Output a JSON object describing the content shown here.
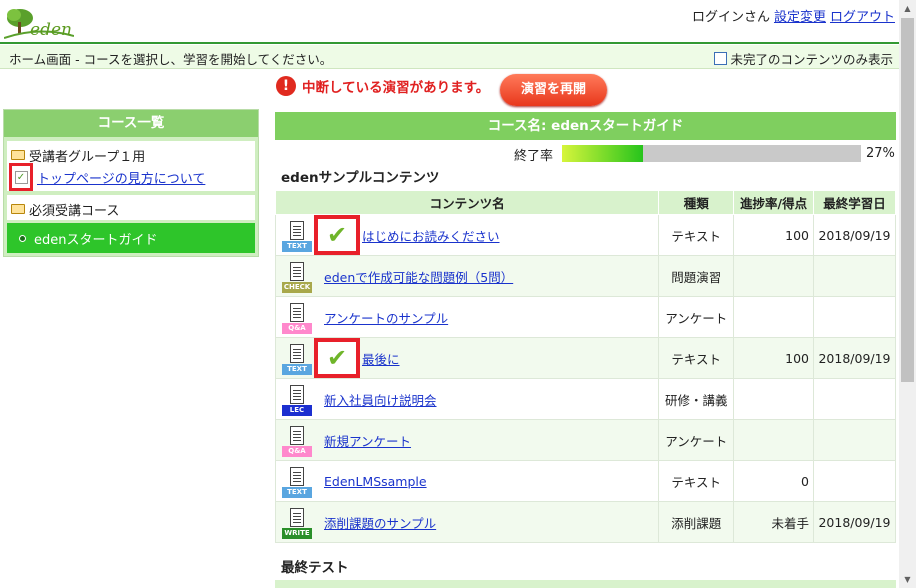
{
  "header": {
    "logo_text": "eden",
    "user_name": "ログインさん",
    "settings_link": "設定変更",
    "logout_link": "ログアウト"
  },
  "statusbar": {
    "message": "ホーム画面 - コースを選択し、学習を開始してください。",
    "filter_label": "未完了のコンテンツのみ表示"
  },
  "sidebar": {
    "title": "コース一覧",
    "groups": [
      {
        "label": "受講者グループ１用",
        "items": [
          {
            "label": "トップページの見方について"
          }
        ]
      },
      {
        "label": "必須受講コース",
        "items": [
          {
            "label": "edenスタートガイド"
          }
        ]
      }
    ]
  },
  "alert": {
    "icon": "!",
    "message": "中断している演習があります。",
    "button": "演習を再開"
  },
  "course": {
    "header": "コース名: edenスタートガイド",
    "progress_label": "終了率",
    "progress_value": 27,
    "progress_text": "27%"
  },
  "sections": {
    "contents_title": "edenサンプルコンテンツ",
    "final_title": "最終テスト"
  },
  "table": {
    "headers": [
      "コンテンツ名",
      "種類",
      "進捗率/得点",
      "最終学習日"
    ],
    "rows": [
      {
        "icon": "TEXT",
        "checked": true,
        "name": "はじめにお読みください",
        "type": "テキスト",
        "progress": "100",
        "date": "2018/09/19"
      },
      {
        "icon": "CHECK",
        "checked": false,
        "name": "edenで作成可能な問題例（5問）",
        "type": "問題演習",
        "progress": "",
        "date": ""
      },
      {
        "icon": "Q&A",
        "checked": false,
        "name": "アンケートのサンプル",
        "type": "アンケート",
        "progress": "",
        "date": ""
      },
      {
        "icon": "TEXT",
        "checked": true,
        "name": "最後に",
        "type": "テキスト",
        "progress": "100",
        "date": "2018/09/19"
      },
      {
        "icon": "LEC",
        "checked": false,
        "name": "新入社員向け説明会",
        "type": "研修・講義",
        "progress": "",
        "date": ""
      },
      {
        "icon": "Q&A",
        "checked": false,
        "name": "新規アンケート",
        "type": "アンケート",
        "progress": "",
        "date": ""
      },
      {
        "icon": "TEXT",
        "checked": false,
        "name": "EdenLMSsample",
        "type": "テキスト",
        "progress": "0",
        "date": ""
      },
      {
        "icon": "WRITE",
        "checked": false,
        "name": "添削課題のサンプル",
        "type": "添削課題",
        "progress": "未着手",
        "date": "2018/09/19"
      }
    ]
  }
}
